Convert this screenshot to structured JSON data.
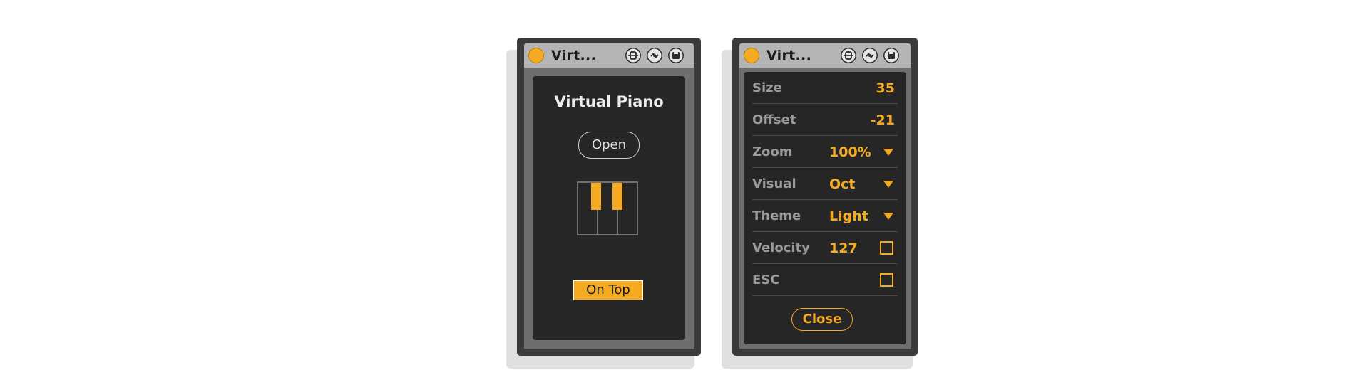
{
  "colors": {
    "accent": "#f5aa24",
    "panel": "#262626",
    "titlebar": "#b4b4b4"
  },
  "left_device": {
    "title": "Virt...",
    "heading": "Virtual Piano",
    "open_label": "Open",
    "ontop_label": "On Top",
    "icons": [
      "power-icon",
      "freeze-icon",
      "map-icon",
      "save-icon",
      "piano-icon"
    ]
  },
  "right_device": {
    "title": "Virt...",
    "params": [
      {
        "label": "Size",
        "value": "35"
      },
      {
        "label": "Offset",
        "value": "-21"
      },
      {
        "label": "Zoom",
        "value": "100%"
      },
      {
        "label": "Visual",
        "value": "Oct"
      },
      {
        "label": "Theme",
        "value": "Light"
      },
      {
        "label": "Velocity",
        "value": "127"
      },
      {
        "label": "ESC",
        "value": ""
      }
    ],
    "close_label": "Close"
  }
}
